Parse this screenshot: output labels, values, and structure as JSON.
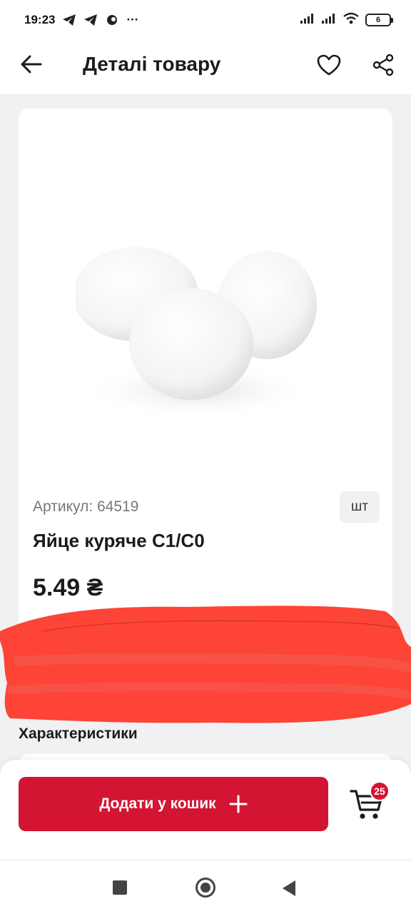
{
  "status_bar": {
    "time": "19:23",
    "more": "···",
    "battery": "6",
    "icons": [
      "telegram-icon",
      "telegram-icon",
      "app-icon",
      "signal-icon",
      "signal-icon",
      "wifi-icon",
      "battery-icon"
    ]
  },
  "header": {
    "title": "Деталі товару",
    "icons": [
      "back-arrow-icon",
      "heart-icon",
      "share-icon"
    ]
  },
  "product": {
    "sku": "Артикул: 64519",
    "unit": "шт",
    "name": "Яйце куряче С1/С0",
    "price": "5.49 ₴",
    "image_icon": "eggs-image"
  },
  "sections": {
    "characteristics": "Характеристики"
  },
  "bottom_bar": {
    "add_to_cart_label": "Додати у кошик",
    "cart_count": "25",
    "icons": [
      "plus-icon",
      "cart-icon"
    ]
  },
  "colors": {
    "accent": "#d31433",
    "redaction": "#fe4437",
    "background": "#f1f1f3"
  }
}
